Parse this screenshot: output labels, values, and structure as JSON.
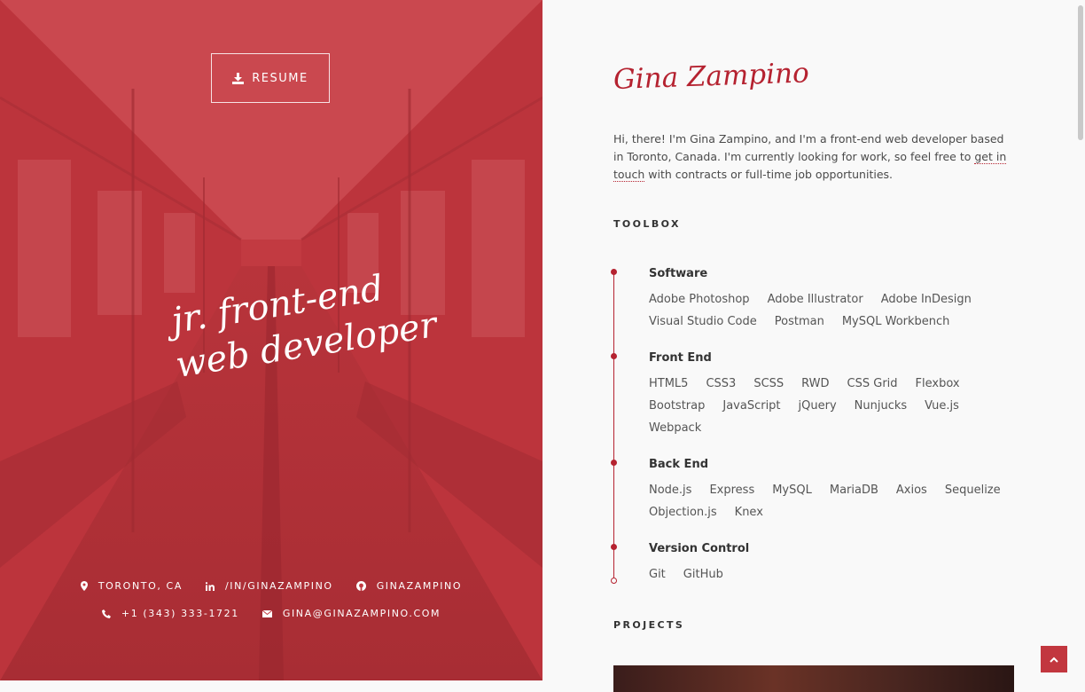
{
  "hero": {
    "resume_label": "RESUME",
    "tagline": [
      "jr. front-end",
      "web developer"
    ],
    "contacts_row1": [
      {
        "icon": "map-pin-icon",
        "text": "TORONTO, CA"
      },
      {
        "icon": "linkedin-icon",
        "text": "/IN/GINAZAMPINO"
      },
      {
        "icon": "github-icon",
        "text": "GINAZAMPINO"
      }
    ],
    "contacts_row2": [
      {
        "icon": "phone-icon",
        "text": "+1 (343) 333-1721"
      },
      {
        "icon": "envelope-icon",
        "text": "GINA@GINAZAMPINO.COM"
      }
    ],
    "overlay_color": "#c23a41"
  },
  "content": {
    "name": "Gina Zampino",
    "intro_before": "Hi, there! I'm Gina Zampino, and I'm a front-end web developer based in Toronto, Canada. I'm currently looking for work, so feel free to ",
    "intro_link": "get in touch",
    "intro_after": " with contracts or full-time job opportunities.",
    "toolbox_title": "TOOLBOX",
    "groups": [
      {
        "title": "Software",
        "items": [
          "Adobe Photoshop",
          "Adobe Illustrator",
          "Adobe InDesign",
          "Visual Studio Code",
          "Postman",
          "MySQL Workbench"
        ]
      },
      {
        "title": "Front End",
        "items": [
          "HTML5",
          "CSS3",
          "SCSS",
          "RWD",
          "CSS Grid",
          "Flexbox",
          "Bootstrap",
          "JavaScript",
          "jQuery",
          "Nunjucks",
          "Vue.js",
          "Webpack"
        ]
      },
      {
        "title": "Back End",
        "items": [
          "Node.js",
          "Express",
          "MySQL",
          "MariaDB",
          "Axios",
          "Sequelize",
          "Objection.js",
          "Knex"
        ]
      },
      {
        "title": "Version Control",
        "items": [
          "Git",
          "GitHub"
        ]
      }
    ],
    "projects_title": "PROJECTS",
    "accent_color": "#b52230"
  }
}
